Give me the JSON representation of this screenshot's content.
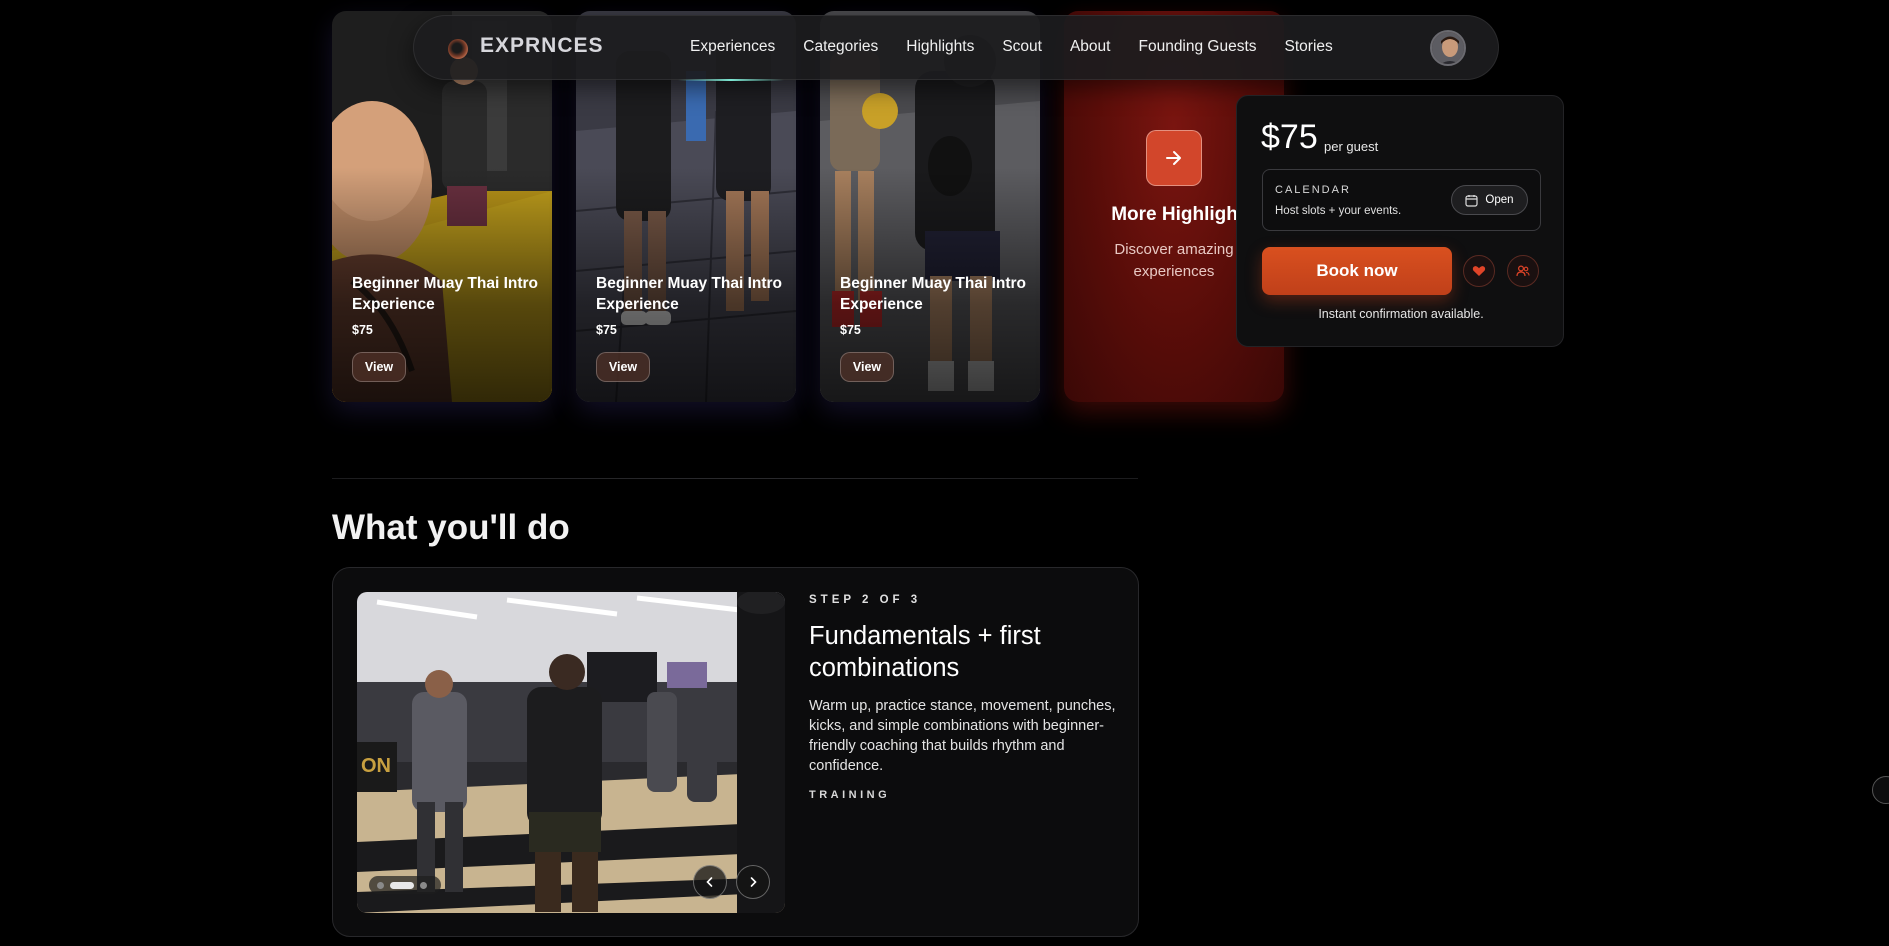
{
  "navbar": {
    "brand": "EXPRNCES",
    "links": [
      "Experiences",
      "Categories",
      "Highlights",
      "Scout",
      "About",
      "Founding Guests",
      "Stories"
    ]
  },
  "highlights": {
    "cards": [
      {
        "title": "Beginner Muay Thai Intro Experience",
        "price": "$75",
        "view_label": "View"
      },
      {
        "title": "Beginner Muay Thai Intro Experience",
        "price": "$75",
        "view_label": "View"
      },
      {
        "title": "Beginner Muay Thai Intro Experience",
        "price": "$75",
        "view_label": "View"
      }
    ],
    "more": {
      "title": "More Highlights",
      "subtitle": "Discover amazing experiences"
    }
  },
  "booking": {
    "price": "$75",
    "per_label": "per guest",
    "calendar_label": "CALENDAR",
    "calendar_sub": "Host slots + your events.",
    "open_label": "Open",
    "book_label": "Book now",
    "confirmation": "Instant confirmation available."
  },
  "section": {
    "title": "What you'll do",
    "step_eyebrow": "STEP 2 OF 3",
    "step_title": "Fundamentals + first combinations",
    "step_desc": "Warm up, practice stance, movement, punches, kicks, and simple combinations with beginner-friendly coaching that builds rhythm and confidence.",
    "step_tag": "TRAINING",
    "carousel_active": 2,
    "carousel_total": 3
  },
  "colors": {
    "accent": "#d2462b",
    "background": "#000000",
    "nav_underline": "#7de7d3"
  }
}
